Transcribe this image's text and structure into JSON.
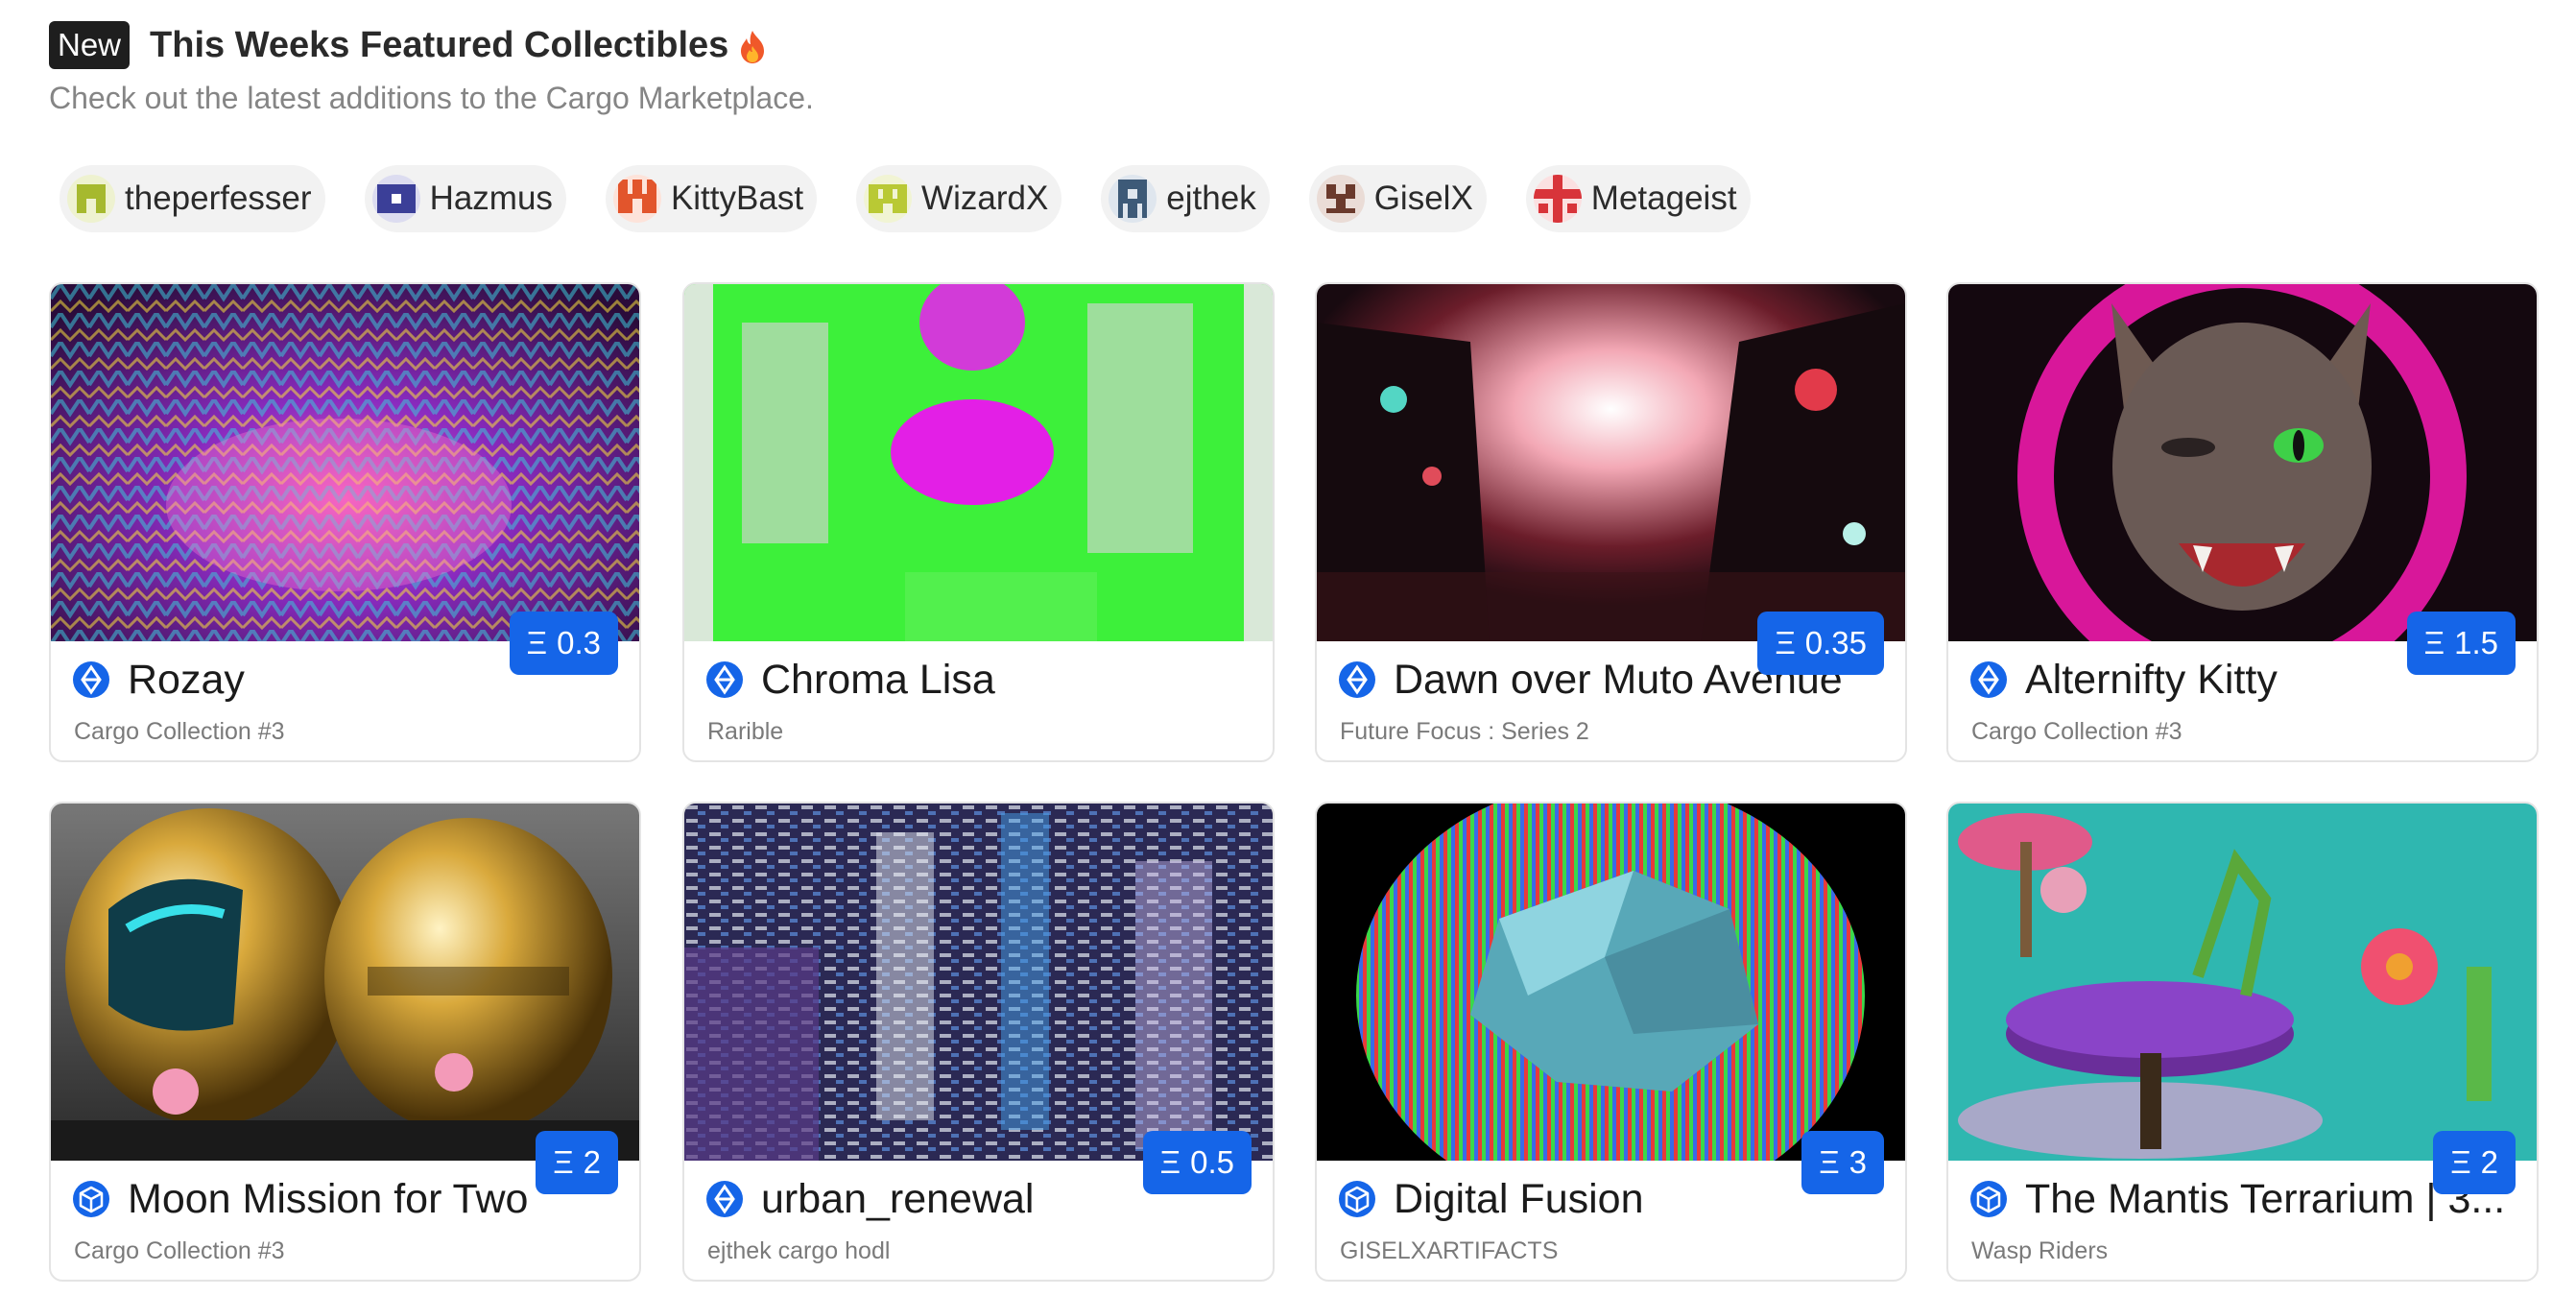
{
  "header": {
    "badge": "New",
    "title": "This Weeks Featured Collectibles",
    "subtitle": "Check out the latest additions to the Cargo Marketplace."
  },
  "creators": [
    {
      "name": "theperfesser",
      "color": "#a6b92e"
    },
    {
      "name": "Hazmus",
      "color": "#3b3f98"
    },
    {
      "name": "KittyBast",
      "color": "#e2552c"
    },
    {
      "name": "WizardX",
      "color": "#b9c934"
    },
    {
      "name": "ejthek",
      "color": "#3d5a78"
    },
    {
      "name": "GiselX",
      "color": "#6b3a2c"
    },
    {
      "name": "Metageist",
      "color": "#d8343a"
    }
  ],
  "currency_symbol": "Ξ",
  "cards": [
    {
      "title": "Rozay",
      "collection": "Cargo Collection #3",
      "price": "0.3",
      "chain_icon": "ethereum-icon"
    },
    {
      "title": "Chroma Lisa",
      "collection": "Rarible",
      "price": "",
      "chain_icon": "ethereum-icon"
    },
    {
      "title": "Dawn over Muto Avenue",
      "collection": "Future Focus : Series 2",
      "price": "0.35",
      "chain_icon": "ethereum-icon"
    },
    {
      "title": "Alternifty Kitty",
      "collection": "Cargo Collection #3",
      "price": "1.5",
      "chain_icon": "ethereum-icon"
    },
    {
      "title": "Moon Mission for Two",
      "collection": "Cargo Collection #3",
      "price": "2",
      "chain_icon": "cube-icon"
    },
    {
      "title": "urban_renewal",
      "collection": "ejthek cargo hodl",
      "price": "0.5",
      "chain_icon": "ethereum-icon"
    },
    {
      "title": "Digital Fusion",
      "collection": "GISELXARTIFACTS",
      "price": "3",
      "chain_icon": "cube-icon"
    },
    {
      "title": "The Mantis Terrarium | 3...",
      "collection": "Wasp Riders",
      "price": "2",
      "chain_icon": "cube-icon"
    }
  ],
  "colors": {
    "accent": "#1565e8",
    "badge_bg": "#1e1e1e"
  }
}
